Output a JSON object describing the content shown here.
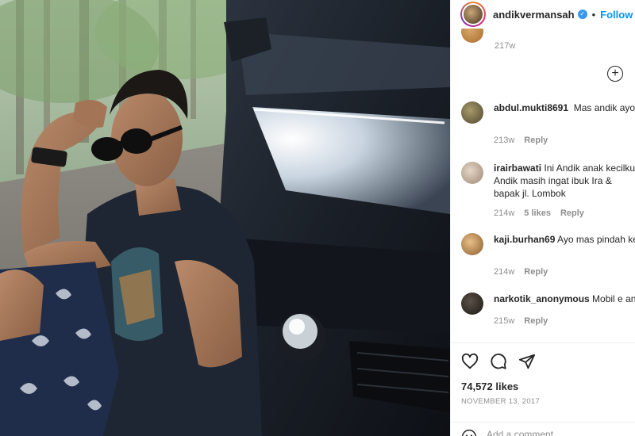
{
  "header": {
    "username": "andikvermansah",
    "separator": "•",
    "follow_label": "Follow"
  },
  "caption": {
    "time": "217w"
  },
  "comments": [
    {
      "username": "abdul.mukti8691",
      "text": "Mas andik ayo merindukan skil tiki taka mue",
      "time": "213w",
      "likes": "",
      "reply_label": "Reply",
      "avatar_color": "#7a6f4a"
    },
    {
      "username": "irairbawati",
      "text": "Ini Andik anak kecilku Andik masih ingat ibuk Ira & bapak jl. Lombok",
      "time": "214w",
      "likes": "5 likes",
      "reply_label": "Reply",
      "avatar_color": "#c9b7a4"
    },
    {
      "username": "kaji.burhan69",
      "text": "Ayo mas pindah ke senangnya bonek melihatnya 👏",
      "time": "214w",
      "likes": "",
      "reply_label": "Reply",
      "avatar_color": "#c79a5a"
    },
    {
      "username": "narkotik_anonymous",
      "text": "Mobil e any",
      "time": "215w",
      "likes": "",
      "reply_label": "Reply",
      "avatar_color": "#2f2a26"
    }
  ],
  "actions": {
    "likes_count": "74,572 likes",
    "post_date": "NOVEMBER 13, 2017",
    "add_comment_placeholder": "Add a comment..."
  },
  "icons": {
    "like": "heart-icon",
    "comment": "comment-icon",
    "share": "paper-plane-icon",
    "load_more": "plus-circle-icon",
    "emoji": "emoji-icon",
    "verified": "verified-badge-icon"
  },
  "colors": {
    "follow_blue": "#0095f6",
    "verified_blue": "#3897f0",
    "meta_gray": "#8e8e8e",
    "text": "#262626"
  }
}
